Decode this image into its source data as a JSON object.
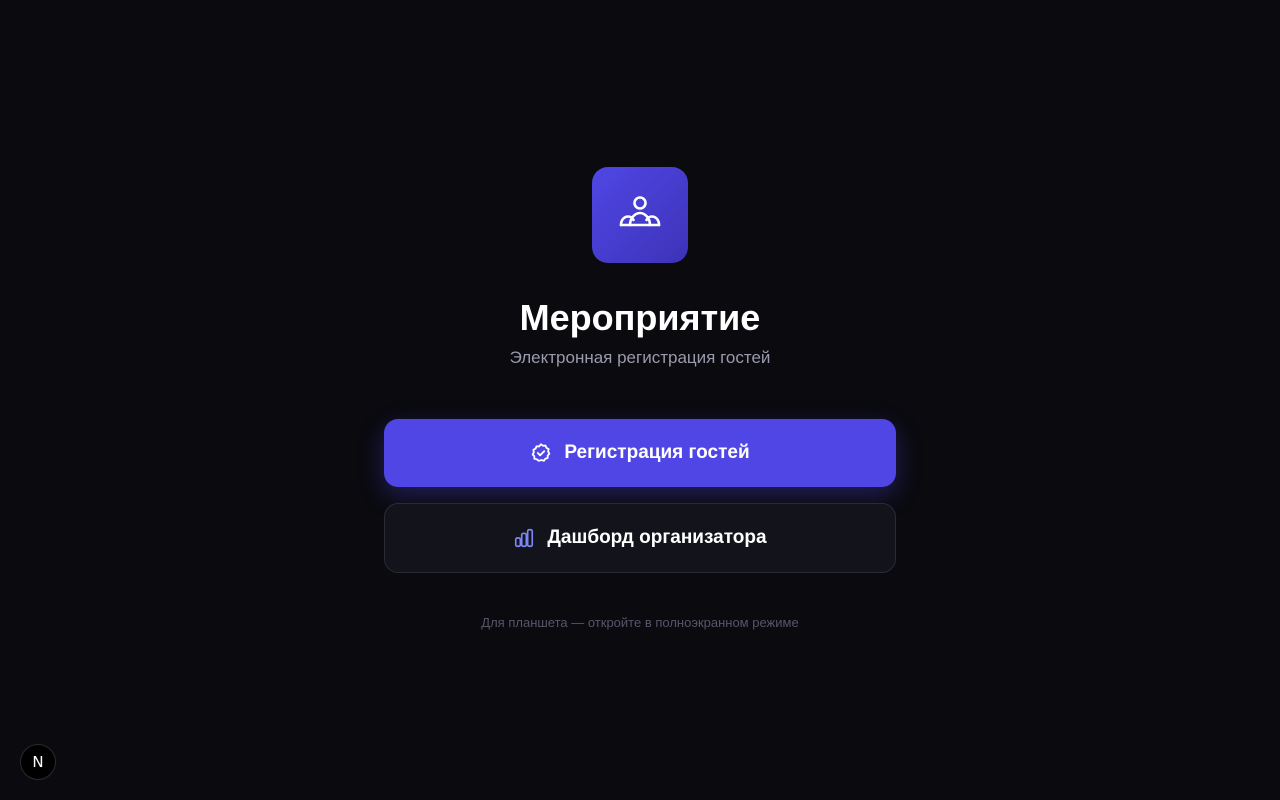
{
  "app": {
    "title": "Мероприятие",
    "subtitle": "Электронная регистрация гостей",
    "logo_icon": "users-icon",
    "accent_color": "#5046e5"
  },
  "actions": {
    "primary": {
      "label": "Регистрация гостей",
      "icon": "check-badge-icon"
    },
    "secondary": {
      "label": "Дашборд организатора",
      "icon": "bar-chart-icon"
    }
  },
  "hint": "Для планшета — откройте в полноэкранном режиме",
  "dev_badge": {
    "letter": "N",
    "icon": "nextjs-icon"
  }
}
